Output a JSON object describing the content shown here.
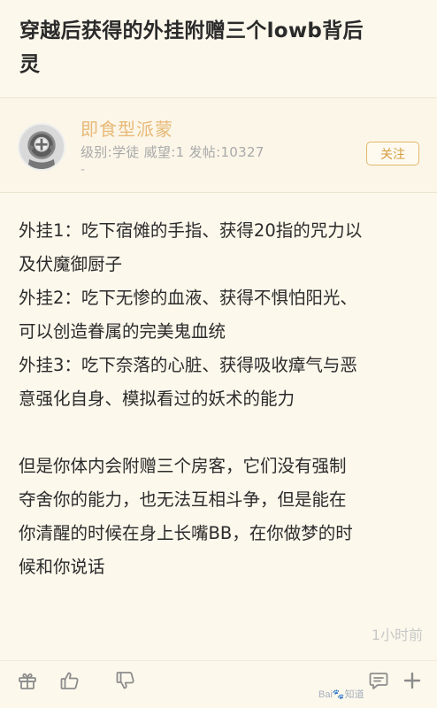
{
  "post": {
    "title_line1": "穿越后获得的外挂附赠三个lowb背后",
    "title_line2": "灵"
  },
  "author": {
    "name": "即食型派蒙",
    "meta": "级别:学徒 威望:1 发帖:10327",
    "meta_extra": "-",
    "follow_label": "关注"
  },
  "body": {
    "lines": [
      "外挂1：吃下宿傩的手指、获得20指的咒力以",
      "及伏魔御厨子",
      "外挂2：吃下无惨的血液、获得不惧怕阳光、",
      "可以创造眷属的完美鬼血统",
      "外挂3：吃下奈落的心脏、获得吸收瘴气与恶",
      "意强化自身、模拟看过的妖术的能力",
      "",
      "但是你体内会附赠三个房客，它们没有强制",
      "夺舍你的能力，也无法互相斗争，但是能在",
      "你清醒的时候在身上长嘴BB，在你做梦的时",
      "候和你说话"
    ]
  },
  "timestamp": "1小时前",
  "toolbar": {
    "icons": [
      "gift-icon",
      "thumbs-up-icon",
      "thumbs-down-icon",
      "comment-icon",
      "plus-icon"
    ]
  },
  "watermark": "Bai🐾知道"
}
